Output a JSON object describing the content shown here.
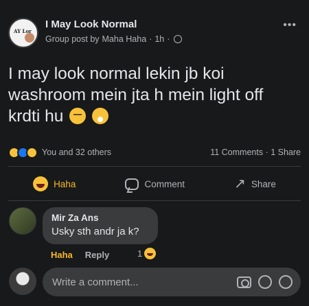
{
  "post": {
    "group_name": "I May Look Normal",
    "meta_prefix": "Group post by",
    "author": "Maha Haha",
    "dot1": "·",
    "time": "1h",
    "dot2": "·",
    "more": "•••",
    "text": "I may look normal lekin jb koi washroom mein jta h mein light off krdti hu",
    "emojis": [
      "face-with-rolling-eyes-emoji",
      "face-with-hand-over-mouth-emoji"
    ],
    "avatar_text": "AY Lor"
  },
  "reactions": {
    "icons": [
      "haha-reaction-icon",
      "like-reaction-icon",
      "sad-reaction-icon"
    ],
    "summary": "You and 32 others",
    "comments": "11 Comments",
    "sep": "·",
    "shares": "1 Share"
  },
  "actions": {
    "haha": "Haha",
    "comment": "Comment",
    "share": "Share"
  },
  "comment": {
    "author": "Mir Za Ans",
    "text": "Usky sth andr ja k?",
    "haha": "Haha",
    "reply": "Reply",
    "reaction_count": "1"
  },
  "composer": {
    "placeholder": "Write a comment..."
  },
  "colors": {
    "background": "#18191a",
    "bubble": "#3a3b3c",
    "text": "#e4e6eb",
    "muted": "#b0b3b8",
    "haha_accent": "#f7b928",
    "like_blue": "#1877f2"
  }
}
